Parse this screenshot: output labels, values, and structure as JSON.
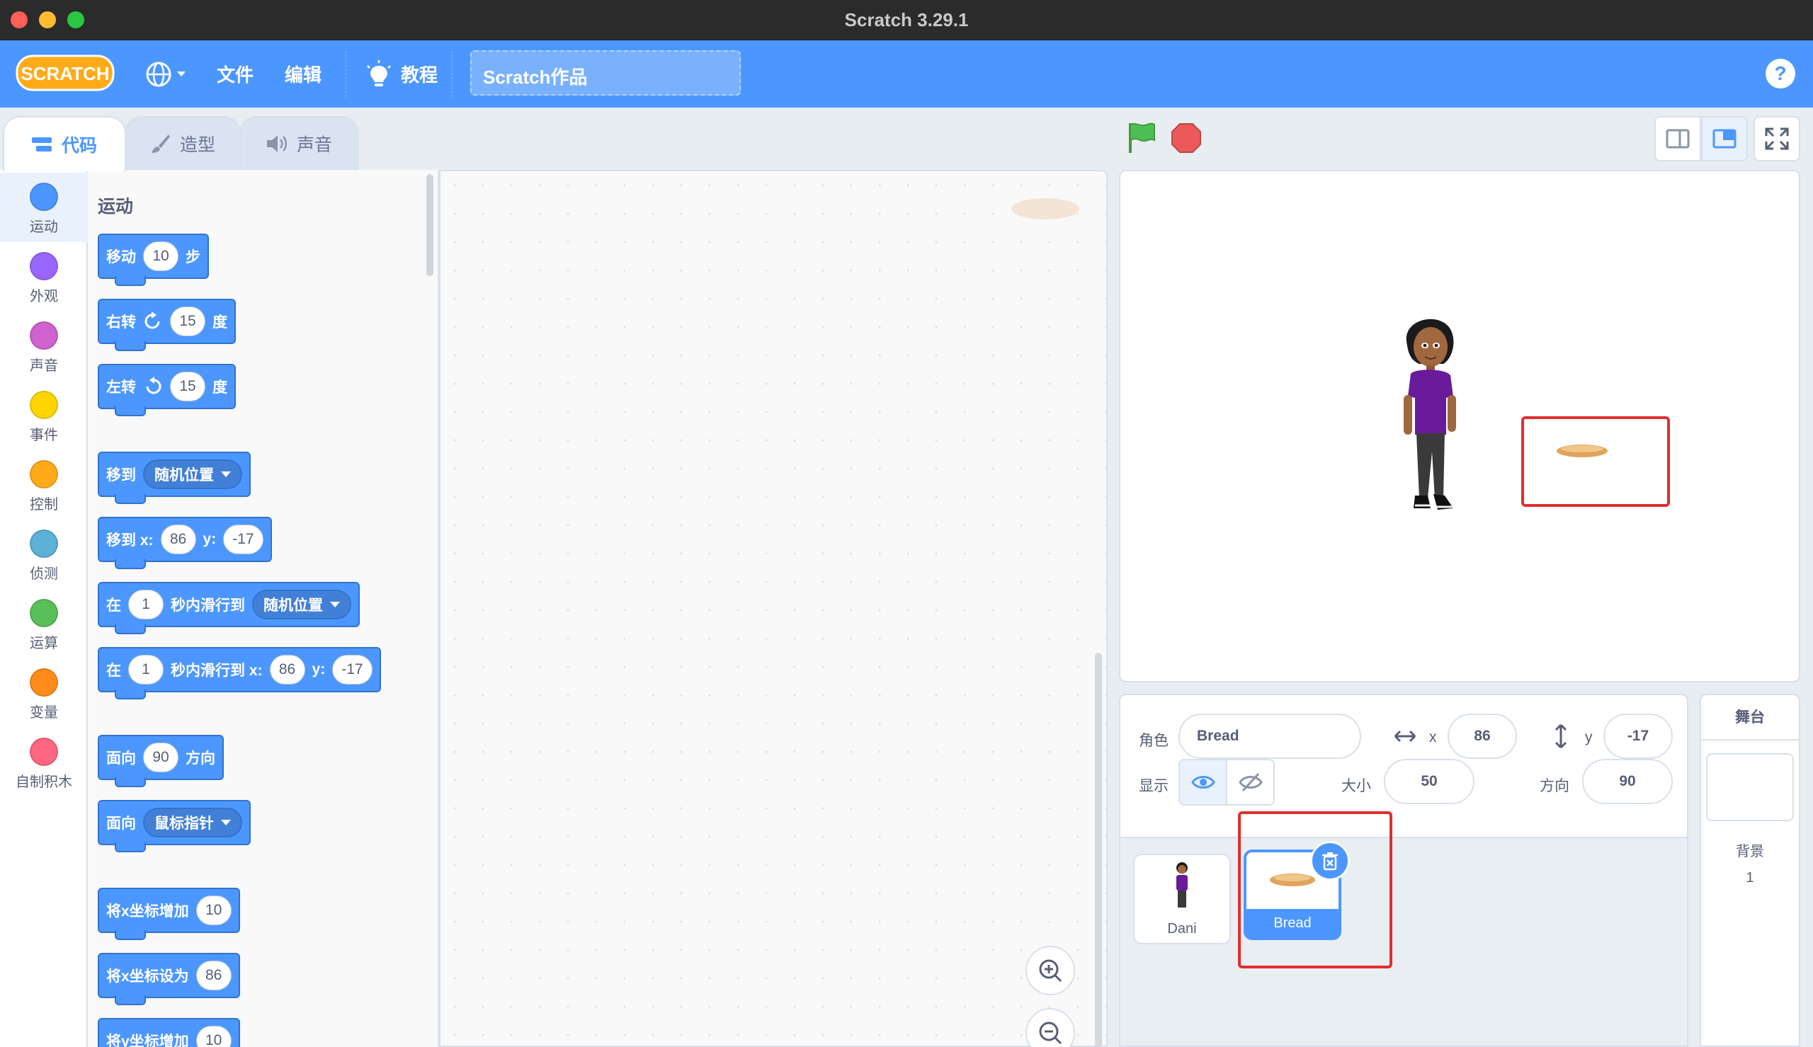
{
  "window": {
    "title": "Scratch 3.29.1"
  },
  "menu": {
    "logo_text": "SCRATCH",
    "file": "文件",
    "edit": "编辑",
    "tutorials": "教程",
    "project_title": "Scratch作品",
    "help": "?"
  },
  "tabs": {
    "code": "代码",
    "costumes": "造型",
    "sounds": "声音"
  },
  "categories": [
    {
      "label": "运动",
      "color": "#4c97ff"
    },
    {
      "label": "外观",
      "color": "#9966ff"
    },
    {
      "label": "声音",
      "color": "#cf63cf"
    },
    {
      "label": "事件",
      "color": "#ffd500"
    },
    {
      "label": "控制",
      "color": "#ffab19"
    },
    {
      "label": "侦测",
      "color": "#5cb1d6"
    },
    {
      "label": "运算",
      "color": "#59c059"
    },
    {
      "label": "变量",
      "color": "#ff8c1a"
    },
    {
      "label": "自制积木",
      "color": "#ff6680"
    }
  ],
  "palette": {
    "heading": "运动",
    "move": {
      "label": "移动",
      "steps": "10",
      "unit": "步"
    },
    "turn_right": {
      "label": "右转",
      "degrees": "15",
      "unit": "度"
    },
    "turn_left": {
      "label": "左转",
      "degrees": "15",
      "unit": "度"
    },
    "goto": {
      "label": "移到",
      "target": "随机位置"
    },
    "goto_xy": {
      "label": "移到 x:",
      "x": "86",
      "ylabel": "y:",
      "y": "-17"
    },
    "glide": {
      "prefix": "在",
      "secs": "1",
      "label": "秒内滑行到",
      "target": "随机位置"
    },
    "glide_xy": {
      "prefix": "在",
      "secs": "1",
      "label": "秒内滑行到 x:",
      "x": "86",
      "ylabel": "y:",
      "y": "-17"
    },
    "point_dir": {
      "label": "面向",
      "value": "90",
      "unit": "方向"
    },
    "point_towards": {
      "label": "面向",
      "target": "鼠标指针"
    },
    "change_x": {
      "label": "将x坐标增加",
      "value": "10"
    },
    "set_x": {
      "label": "将x坐标设为",
      "value": "86"
    },
    "change_y": {
      "label": "将y坐标增加",
      "value": "10"
    }
  },
  "sprite_info": {
    "sprite_label": "角色",
    "sprite_name": "Bread",
    "x_label": "x",
    "x": "86",
    "y_label": "y",
    "y": "-17",
    "show_label": "显示",
    "size_label": "大小",
    "size": "50",
    "direction_label": "方向",
    "direction": "90"
  },
  "sprites": [
    {
      "name": "Dani",
      "selected": false
    },
    {
      "name": "Bread",
      "selected": true
    }
  ],
  "stage_pane": {
    "title": "舞台",
    "backdrops_label": "背景",
    "backdrops_count": "1"
  },
  "colors": {
    "accent": "#4c97ff",
    "highlight": "#e02e2e",
    "go": "#4cbf56",
    "stop": "#ec5959"
  }
}
